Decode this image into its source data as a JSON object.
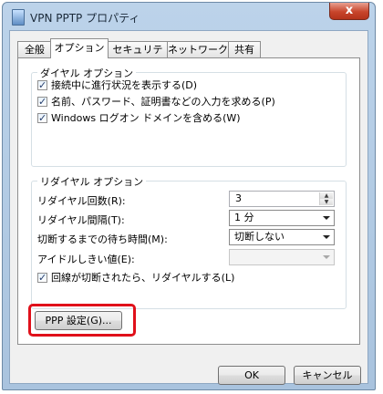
{
  "window": {
    "title": "VPN PPTP プロパティ",
    "close_glyph": "x"
  },
  "tabs": [
    {
      "label": "全般",
      "active": false
    },
    {
      "label": "オプション",
      "active": true
    },
    {
      "label": "セキュリティ",
      "active": false
    },
    {
      "label": "ネットワーク",
      "active": false
    },
    {
      "label": "共有",
      "active": false
    }
  ],
  "dial_options": {
    "legend": "ダイヤル オプション",
    "items": [
      {
        "label": "接続中に進行状況を表示する(D)",
        "checked": true
      },
      {
        "label": "名前、パスワード、証明書などの入力を求める(P)",
        "checked": true
      },
      {
        "label": "Windows ログオン ドメインを含める(W)",
        "checked": true
      }
    ]
  },
  "redial_options": {
    "legend": "リダイヤル オプション",
    "redial_attempts_label": "リダイヤル回数(R):",
    "redial_attempts_value": "3",
    "redial_interval_label": "リダイヤル間隔(T):",
    "redial_interval_value": "1 分",
    "idle_hangup_label": "切断するまでの待ち時間(M):",
    "idle_hangup_value": "切断しない",
    "idle_threshold_label": "アイドルしきい値(E):",
    "idle_threshold_value": "",
    "redial_on_drop_label": "回線が切断されたら、リダイヤルする(L)",
    "redial_on_drop_checked": true
  },
  "ppp_settings_button": "PPP 設定(G)...",
  "footer": {
    "ok_label": "OK",
    "cancel_label": "キャンセル"
  },
  "colors": {
    "highlight": "#e0101a",
    "window_frame": "#a9c3de"
  }
}
